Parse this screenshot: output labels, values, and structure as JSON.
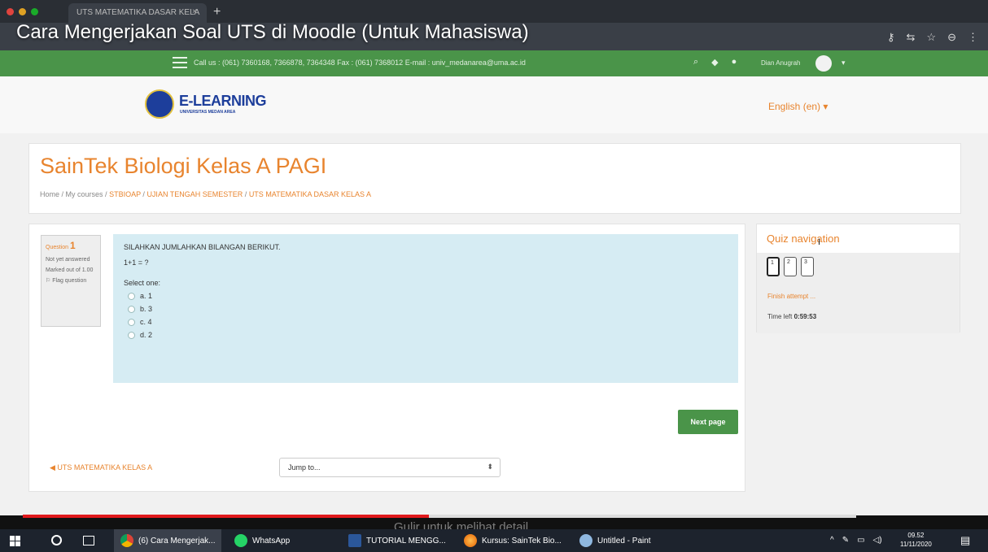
{
  "browser": {
    "tab_title": "UTS MATEMATIKA DASAR KELA",
    "tab_close": "×",
    "new_tab": "+",
    "address_icons": [
      "key-icon",
      "translate-icon",
      "star-icon",
      "account-icon",
      "menu-icon"
    ]
  },
  "video": {
    "title": "Cara Mengerjakan Soal UTS di Moodle (Untuk Mahasiswa)",
    "progress_fraction": 0.487,
    "caption": "Gulir untuk melihat detail"
  },
  "topbar": {
    "contact": "Call us : (061) 7360168, 7366878, 7364348 Fax : (061) 7368012  E-mail : univ_medanarea@uma.ac.id",
    "user_name": "Dian Anugrah",
    "caret": "▾"
  },
  "header": {
    "logo_text": "E-LEARNING",
    "logo_subtext": "UNIVERSITAS MEDAN AREA",
    "language": "English (en) ▾"
  },
  "course": {
    "title": "SainTek Biologi Kelas A PAGI",
    "breadcrumb": {
      "home": "Home",
      "sep": " / ",
      "courses": "My courses",
      "code": "STBIOAP",
      "section": "UJIAN TENGAH SEMESTER",
      "quiz": "UTS MATEMATIKA DASAR KELAS A"
    }
  },
  "question": {
    "label": "Question",
    "number": "1",
    "status": "Not yet answered",
    "marks": "Marked out of 1.00",
    "flag": "Flag question",
    "text": "SILAHKAN JUMLAHKAN BILANGAN BERIKUT.",
    "expression": "1+1 = ?",
    "select_label": "Select one:",
    "options": [
      "a. 1",
      "b. 3",
      "c. 4",
      "d. 2"
    ],
    "next_label": "Next page",
    "prev_link": "◀ UTS MATEMATIKA KELAS A",
    "jump_label": "Jump to...",
    "jump_caret": "⬍"
  },
  "quiz_nav": {
    "title": "Quiz navigation",
    "buttons": [
      "1",
      "2",
      "3"
    ],
    "current": "1",
    "finish": "Finish attempt ...",
    "time_label": "Time left ",
    "time_value": "0:59:53"
  },
  "taskbar": {
    "items": [
      "(6) Cara Mengerjak...",
      "WhatsApp",
      "TUTORIAL MENGG...",
      "Kursus: SainTek Bio...",
      "Untitled - Paint"
    ],
    "whatsapp_badge": "2",
    "time": "09.52",
    "date": "11/11/2020",
    "notification_count": "1"
  },
  "colors": {
    "moodle_green": "#4a9449",
    "moodle_orange": "#e8842e",
    "question_bg": "#d6ecf3",
    "progress_red": "#e0191c"
  }
}
